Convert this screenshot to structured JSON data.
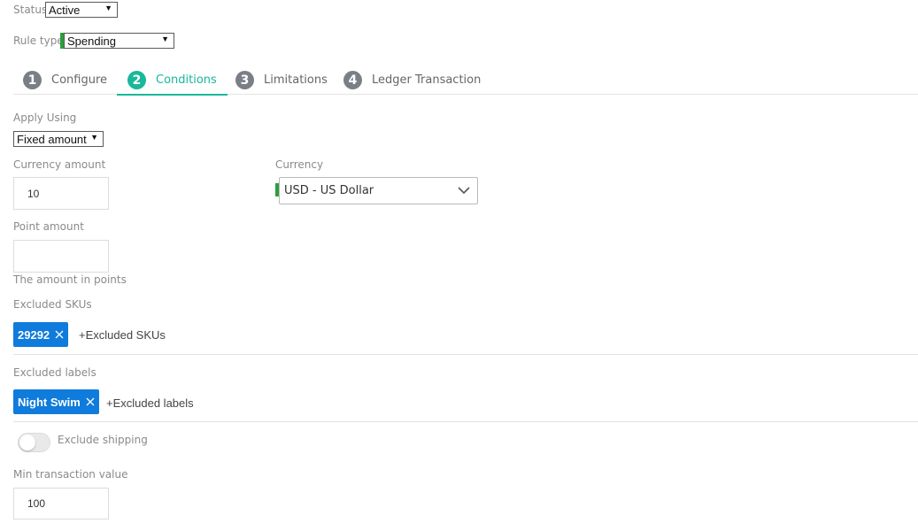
{
  "status": {
    "label": "Status",
    "value": "Active"
  },
  "rule_type": {
    "label": "Rule type",
    "value": "Spending"
  },
  "tabs": [
    {
      "num": "1",
      "label": "Configure"
    },
    {
      "num": "2",
      "label": "Conditions",
      "active": true
    },
    {
      "num": "3",
      "label": "Limitations"
    },
    {
      "num": "4",
      "label": "Ledger Transaction"
    }
  ],
  "apply_using": {
    "label": "Apply Using",
    "value": "Fixed amount"
  },
  "currency_amount": {
    "label": "Currency amount",
    "value": "10"
  },
  "currency": {
    "label": "Currency",
    "value": "USD - US Dollar"
  },
  "point_amount": {
    "label": "Point amount",
    "value": "",
    "help": "The amount in points"
  },
  "excluded_skus": {
    "label": "Excluded SKUs",
    "chips": [
      "29292"
    ],
    "add_label": "+Excluded SKUs"
  },
  "excluded_labels": {
    "label": "Excluded labels",
    "chips": [
      "Night Swim"
    ],
    "add_label": "+Excluded labels"
  },
  "exclude_shipping": {
    "label": "Exclude shipping",
    "enabled": false
  },
  "min_transaction": {
    "label": "Min transaction value",
    "value": "100"
  },
  "colors": {
    "accent": "#19b89a",
    "chip": "#0f7bdc",
    "required": "#2e9e3e",
    "tab_inactive": "#7a7f87"
  }
}
